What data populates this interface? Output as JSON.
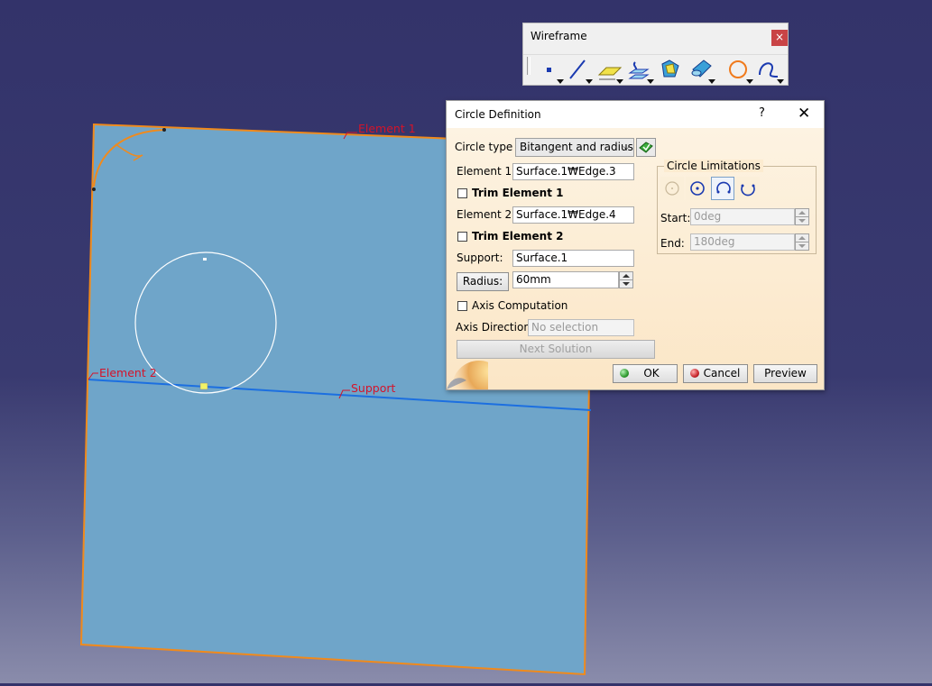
{
  "viewport": {
    "annotations": {
      "element1": "Element 1",
      "element2": "Element 2",
      "support": "Support"
    }
  },
  "toolbar": {
    "title": "Wireframe",
    "close_glyph": "×",
    "tools": [
      "point-icon",
      "line-icon",
      "plane-icon",
      "projection-icon",
      "extrude-icon",
      "cylinder-icon",
      "circle-icon",
      "spline-icon"
    ]
  },
  "dialog": {
    "title": "Circle Definition",
    "help_glyph": "?",
    "close_glyph": "✕",
    "circle_type_label": "Circle type :",
    "circle_type_value": "Bitangent and radius",
    "element1_label": "Element 1:",
    "element1_value": "Surface.1₩Edge.3",
    "trim1_label": "Trim Element 1",
    "trim1_checked": false,
    "element2_label": "Element 2:",
    "element2_value": "Surface.1₩Edge.4",
    "trim2_label": "Trim Element 2",
    "trim2_checked": false,
    "support_label": "Support:",
    "support_value": "Surface.1",
    "radius_button": "Radius:",
    "radius_value": "60mm",
    "axis_computation_label": "Axis Computation",
    "axis_computation_checked": false,
    "axis_direction_label": "Axis Direction:",
    "axis_direction_placeholder": "No selection",
    "next_solution_label": "Next Solution",
    "limitations": {
      "title": "Circle Limitations",
      "start_label": "Start:",
      "start_value": "0deg",
      "end_label": "End:",
      "end_value": "180deg"
    },
    "ok_label": "OK",
    "cancel_label": "Cancel",
    "preview_label": "Preview",
    "colors": {
      "ok_dot": "#2f9b2f",
      "cancel_dot": "#c8262b"
    }
  },
  "colors": {
    "surface_fill": "#6fa5c9",
    "edge_highlight": "#f08a1c",
    "support_line": "#1c6fe0",
    "annotation_text": "#d4142a"
  }
}
